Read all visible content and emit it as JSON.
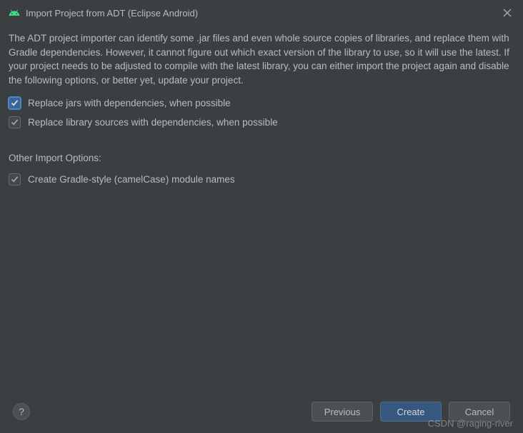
{
  "titlebar": {
    "title": "Import Project from ADT (Eclipse Android)"
  },
  "description": "The ADT project importer can identify some .jar files and even whole source copies of libraries, and replace them with Gradle dependencies. However, it cannot figure out which exact version of the library to use, so it will use the latest. If your project needs to be adjusted to compile with the latest library, you can either import the project again and disable the following options, or better yet, update your project.",
  "checkboxes": {
    "replace_jars": {
      "label": "Replace jars with dependencies, when possible",
      "checked": true
    },
    "replace_lib_sources": {
      "label": "Replace library sources with dependencies, when possible",
      "checked": true
    },
    "camel_case": {
      "label": "Create Gradle-style (camelCase) module names",
      "checked": true
    }
  },
  "section_label": "Other Import Options:",
  "buttons": {
    "previous": "Previous",
    "create": "Create",
    "cancel": "Cancel"
  },
  "help_tooltip": "?",
  "watermark": "CSDN @raging-river"
}
